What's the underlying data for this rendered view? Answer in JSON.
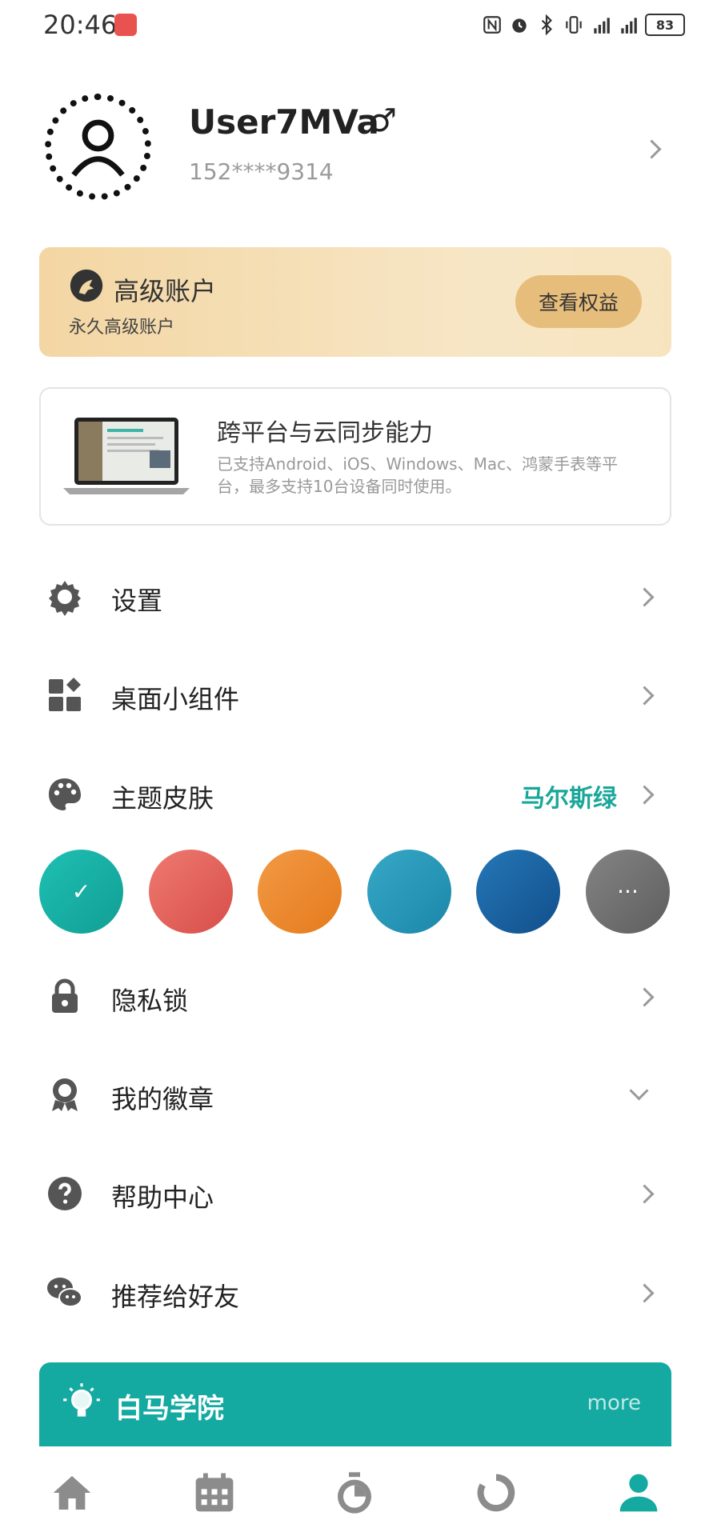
{
  "status": {
    "time": "20:46",
    "battery": "83"
  },
  "profile": {
    "username": "User7MVa",
    "gender_symbol": "♂",
    "phone": "152****9314"
  },
  "premium": {
    "title": "高级账户",
    "subtitle": "永久高级账户",
    "button": "查看权益"
  },
  "sync": {
    "title": "跨平台与云同步能力",
    "desc": "已支持Android、iOS、Windows、Mac、鸿蒙手表等平台，最多支持10台设备同时使用。"
  },
  "menu": {
    "settings": "设置",
    "widgets": "桌面小组件",
    "theme": "主题皮肤",
    "theme_value": "马尔斯绿",
    "privacy": "隐私锁",
    "badges": "我的徽章",
    "help": "帮助中心",
    "share": "推荐给好友"
  },
  "theme_swatches": {
    "selected_mark": "✓",
    "more_mark": "···",
    "colors": [
      "#15b2a7",
      "#e2605a",
      "#ee8a2e",
      "#2a9dbd",
      "#1b65a6",
      "#6f6f6f"
    ]
  },
  "academy": {
    "title": "白马学院",
    "more": "more"
  },
  "colors": {
    "accent": "#14aaa1",
    "premium_btn": "#e7bd7c",
    "icon_gray": "#555555",
    "nav_active": "#14aaa1"
  },
  "nav": {
    "items": [
      "home-icon",
      "calendar-icon",
      "timer-icon",
      "stats-icon",
      "profile-icon"
    ],
    "active": "profile-icon"
  }
}
